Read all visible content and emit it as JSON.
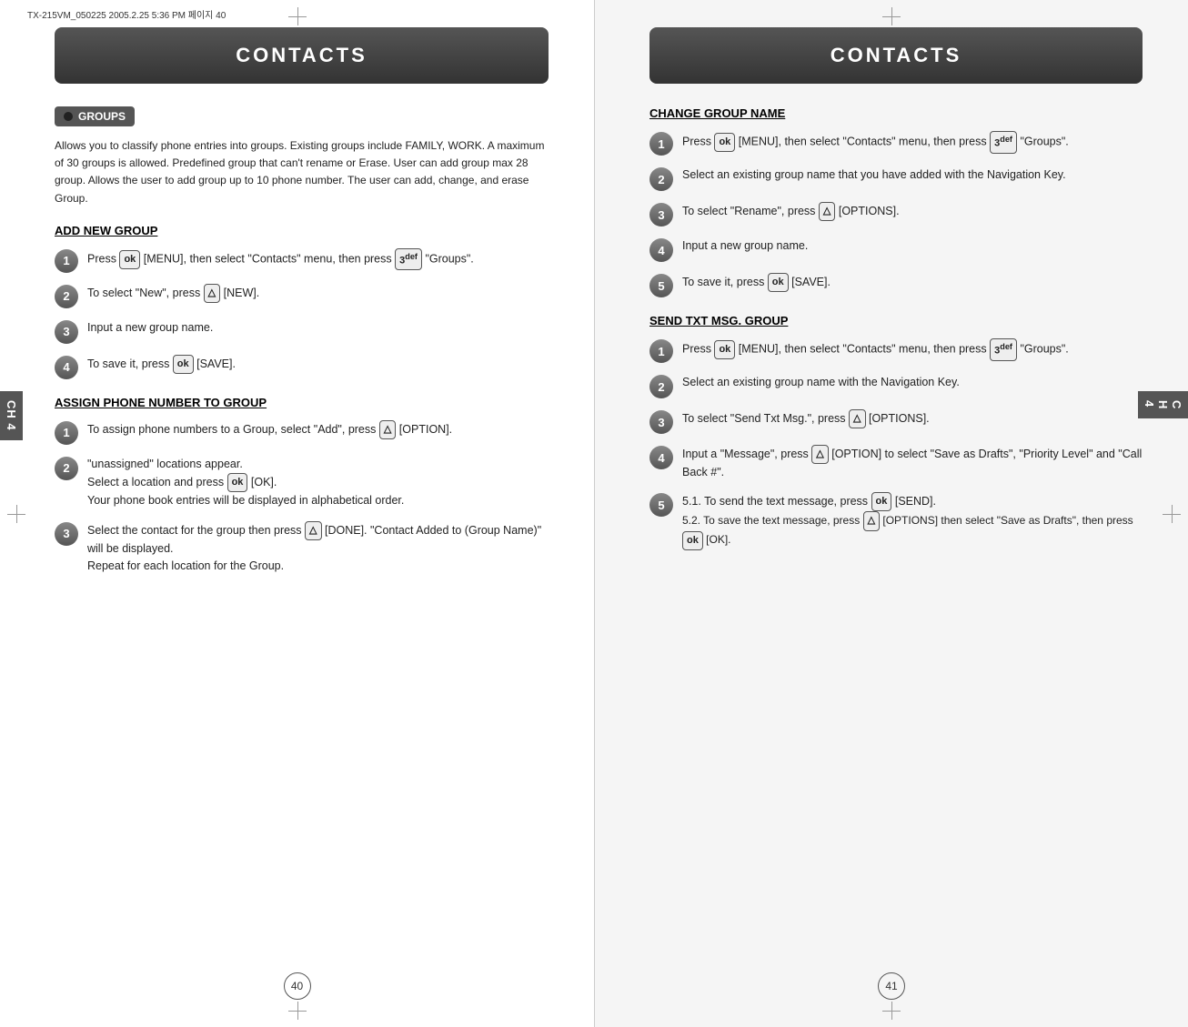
{
  "left": {
    "file_info": "TX-215VM_050225  2005.2.25 5:36 PM 페이지 40",
    "header": "CONTACTS",
    "badge_label": "GROUPS",
    "description": "Allows you to classify phone entries into groups.  Existing groups include FAMILY, WORK.  A maximum of 30 groups is allowed. Predefined group that can't rename or Erase. User can add group max 28 group. Allows the user to add group up to 10 phone number. The user can add, change, and erase Group.",
    "sections": [
      {
        "title": "ADD NEW GROUP",
        "steps": [
          {
            "num": "1",
            "text": "Press [MENU], then select \"Contacts\" menu, then press  \"Groups\"."
          },
          {
            "num": "2",
            "text": "To select \"New\", press  [NEW]."
          },
          {
            "num": "3",
            "text": "Input a new group name."
          },
          {
            "num": "4",
            "text": "To save it, press [SAVE]."
          }
        ]
      },
      {
        "title": "ASSIGN PHONE NUMBER TO GROUP",
        "steps": [
          {
            "num": "1",
            "text": "To assign phone numbers to a Group, select \"Add\", press  [OPTION]."
          },
          {
            "num": "2",
            "text": "\"unassigned\" locations appear. Select a location and press  [OK]. Your phone book entries will be displayed in alphabetical order."
          },
          {
            "num": "3",
            "text": "Select the contact for the group then press  [DONE]. \"Contact Added to (Group Name)\" will be displayed. Repeat for each location for the Group."
          }
        ]
      }
    ],
    "side_tab": "CH\n4",
    "page_number": "40"
  },
  "right": {
    "header": "CONTACTS",
    "sections": [
      {
        "title": "CHANGE GROUP NAME",
        "steps": [
          {
            "num": "1",
            "text": "Press [MENU], then select \"Contacts\" menu, then press  \"Groups\"."
          },
          {
            "num": "2",
            "text": "Select an existing group name that you have added with the Navigation Key."
          },
          {
            "num": "3",
            "text": "To select \"Rename\", press  [OPTIONS]."
          },
          {
            "num": "4",
            "text": "Input a new group name."
          },
          {
            "num": "5",
            "text": "To save it, press [SAVE]."
          }
        ]
      },
      {
        "title": "SEND TXT MSG. GROUP",
        "steps": [
          {
            "num": "1",
            "text": "Press [MENU], then select \"Contacts\" menu, then press  \"Groups\"."
          },
          {
            "num": "2",
            "text": "Select an existing group name with the Navigation Key."
          },
          {
            "num": "3",
            "text": "To select \"Send Txt Msg.\", press  [OPTIONS]."
          },
          {
            "num": "4",
            "text": "Input a \"Message\", press  [OPTION] to select \"Save as Drafts\", \"Priority Level\" and \"Call Back #\"."
          },
          {
            "num": "5",
            "text": "5.1. To send the text message, press [SEND].",
            "sub": "5.2. To save the text message, press  [OPTIONS] then select \"Save as Drafts\", then press [OK]."
          }
        ]
      }
    ],
    "side_tab": "CH\n4",
    "page_number": "41"
  }
}
